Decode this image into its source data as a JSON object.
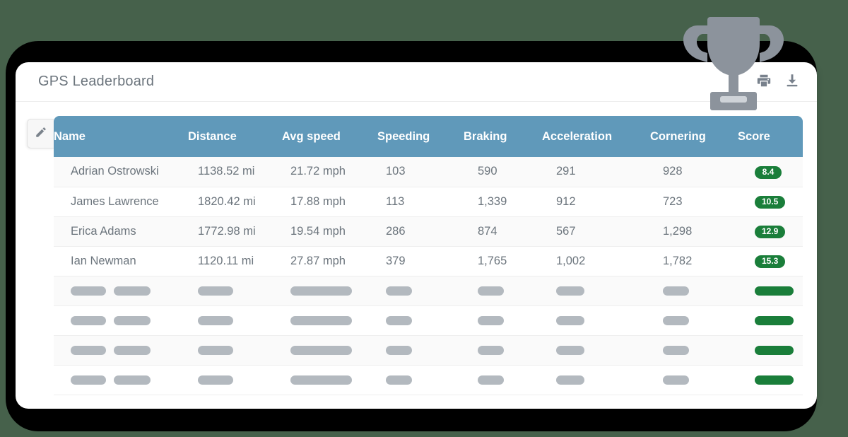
{
  "page_title": "GPS Leaderboard",
  "header_actions": [
    {
      "name": "print-icon",
      "label": "Print"
    },
    {
      "name": "download-icon",
      "label": "Download"
    }
  ],
  "edit_button": {
    "name": "edit-pencil-icon",
    "label": "Edit"
  },
  "decoration": {
    "trophy": "trophy-icon"
  },
  "colors": {
    "header_blue": "#6099ba",
    "score_green": "#1a7e3a",
    "skeleton_gray": "#b3b9bf",
    "text_gray": "#6c757d",
    "bezel": "#000000",
    "page_background": "#46614b"
  },
  "table": {
    "columns": [
      "Name",
      "Distance",
      "Avg speed",
      "Speeding",
      "Braking",
      "Acceleration",
      "Cornering",
      "Score"
    ],
    "rows": [
      {
        "name": "Adrian Ostrowski",
        "distance": "1138.52 mi",
        "avg_speed": "21.72 mph",
        "speeding": "103",
        "braking": "590",
        "acceleration": "291",
        "cornering": "928",
        "score": "8.4"
      },
      {
        "name": "James Lawrence",
        "distance": "1820.42 mi",
        "avg_speed": "17.88 mph",
        "speeding": "113",
        "braking": "1,339",
        "acceleration": "912",
        "cornering": "723",
        "score": "10.5"
      },
      {
        "name": "Erica Adams",
        "distance": "1772.98 mi",
        "avg_speed": "19.54 mph",
        "speeding": "286",
        "braking": "874",
        "acceleration": "567",
        "cornering": "1,298",
        "score": "12.9"
      },
      {
        "name": "Ian Newman",
        "distance": "1120.11 mi",
        "avg_speed": "27.87 mph",
        "speeding": "379",
        "braking": "1,765",
        "acceleration": "1,002",
        "cornering": "1,782",
        "score": "15.3"
      }
    ],
    "placeholder_row_count": 4
  }
}
